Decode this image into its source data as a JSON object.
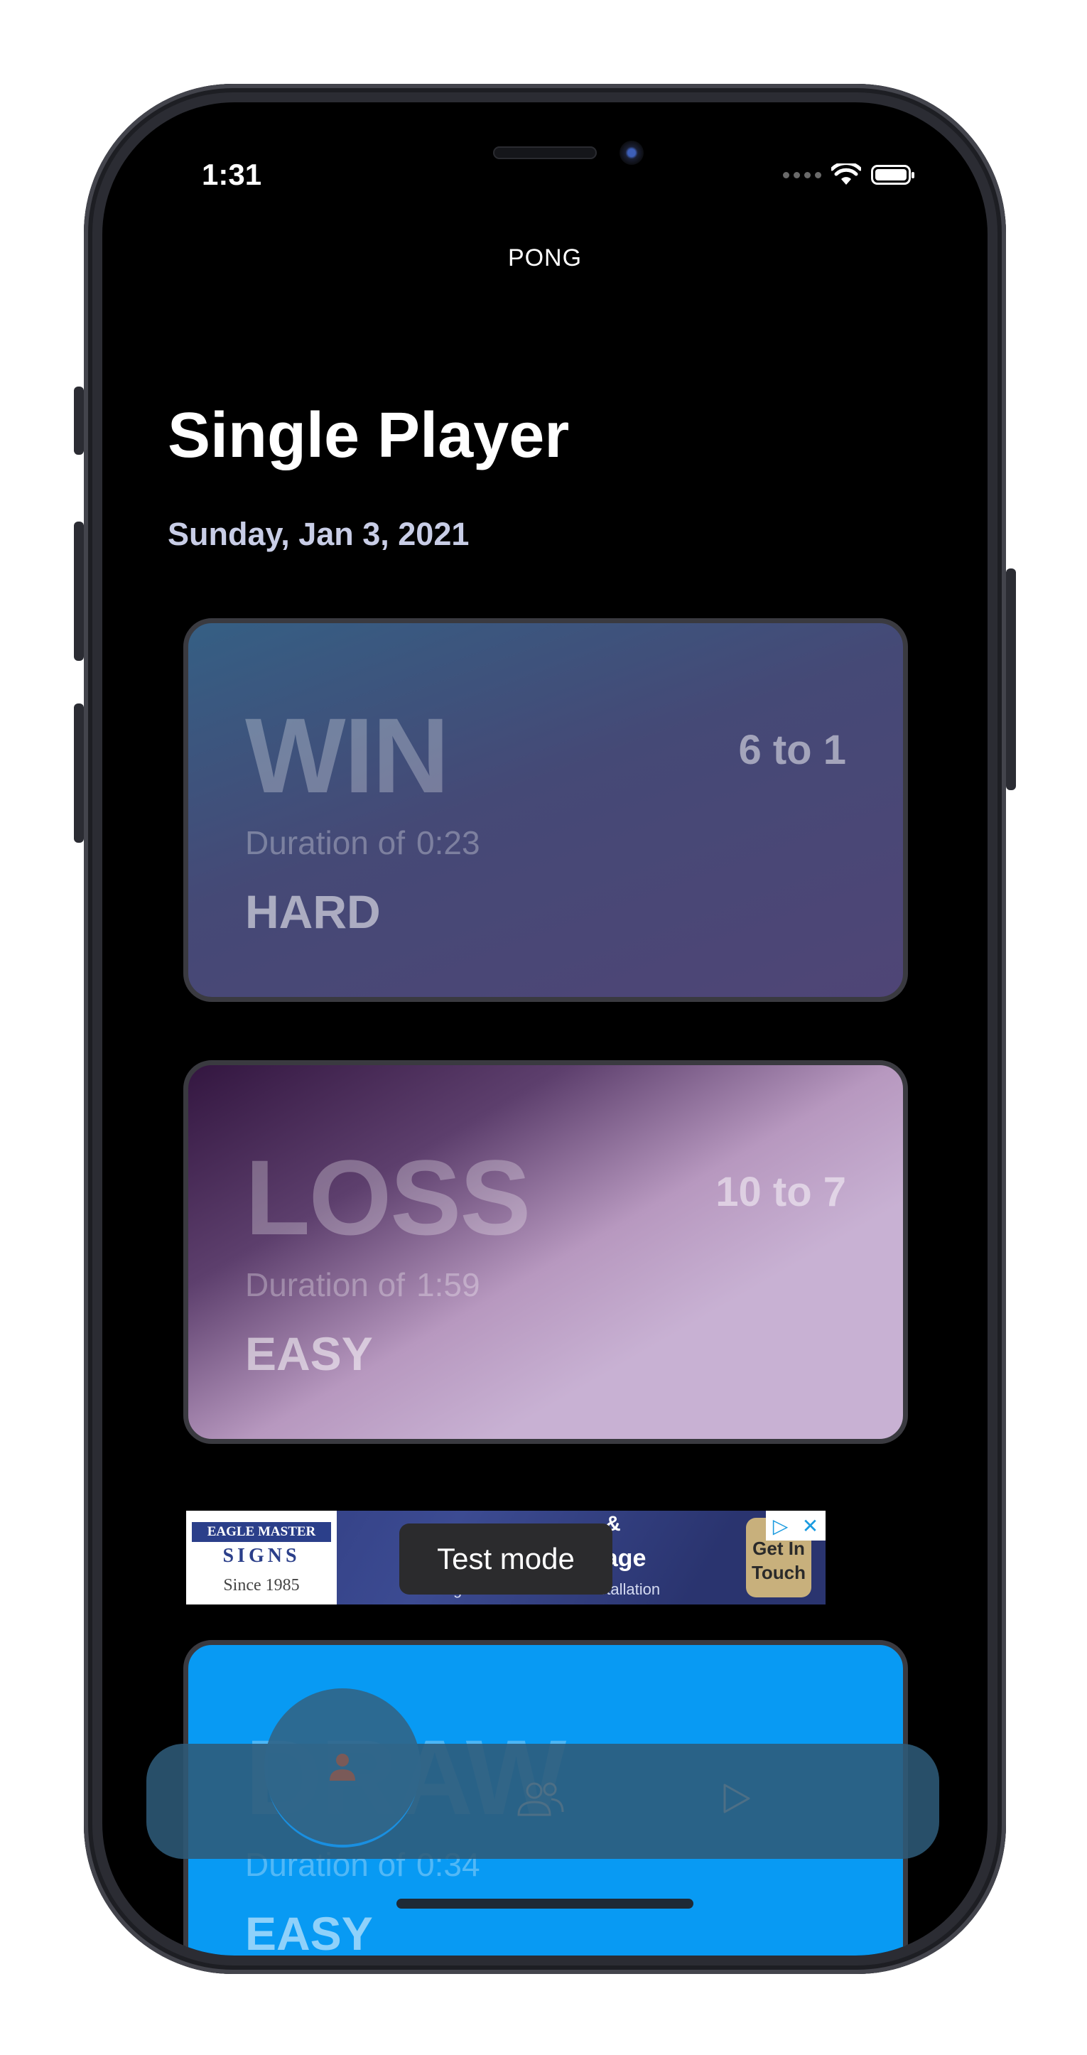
{
  "status_bar": {
    "time": "1:31"
  },
  "nav": {
    "title": "PONG"
  },
  "page": {
    "title": "Single Player",
    "date": "Sunday, Jan 3, 2021"
  },
  "games": [
    {
      "result": "WIN",
      "score": "6 to 1",
      "duration_label": "Duration of",
      "duration": "0:23",
      "difficulty": "HARD"
    },
    {
      "result": "LOSS",
      "score": "10 to 7",
      "duration_label": "Duration of",
      "duration": "1:59",
      "difficulty": "EASY"
    },
    {
      "result": "DRAW",
      "score": "",
      "duration_label": "Duration of",
      "duration": "0:34",
      "difficulty": "EASY"
    }
  ],
  "ad": {
    "logo_line1": "EAGLE MASTER",
    "logo_line2": "SIGNS",
    "logo_line3": "Since 1985",
    "headline1": "&",
    "headline2": "nage",
    "tagline": "Design · Manufacture · Installation",
    "cta": "Get In Touch",
    "test_mode": "Test mode"
  },
  "tab_bar": {
    "items": [
      "single-player",
      "multiplayer",
      "play"
    ],
    "active": "single-player"
  },
  "colors": {
    "win_card": "#4a4a7a",
    "loss_card": "#c8b1d3",
    "draw_card": "#089af3",
    "tab_bar": "#2d5a78"
  }
}
